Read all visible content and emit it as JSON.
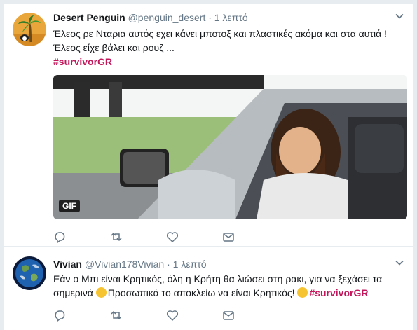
{
  "colors": {
    "hashtag": "#c2185b",
    "meta": "#657786",
    "separator": "#e6ecf0"
  },
  "tweets": [
    {
      "name": "Desert Penguin",
      "handle": "@penguin_desert",
      "dot": "·",
      "time": "1 λεπτό",
      "line1": "Έλεος ρε Νταρια αυτός εχει κάνει μποτοξ και πλαστικές ακόμα και στα  αυτιά  !",
      "line2": "Έλεος είχε βάλει και ρουζ ...",
      "hashtag": "#survivorGR",
      "media_badge": "GIF",
      "avatar_icon": "palm-tree-icon"
    },
    {
      "name": "Vivian",
      "handle": "@Vivian178Vivian",
      "dot": "·",
      "time": "1 λεπτό",
      "line1": "Εάν ο Μπι είναι Κρητικός, όλη η Κρήτη θα λιώσει στη ρακι, για να ξεχάσει τα",
      "line2_a": "σημερινά ",
      "line2_b": "Προσωπικά το αποκλείω να είναι Κρητικός! ",
      "hashtag": "#survivorGR",
      "emoji1": "laughing-emoji-icon",
      "emoji2": "winking-emoji-icon",
      "avatar_icon": "earth-icon"
    }
  ]
}
